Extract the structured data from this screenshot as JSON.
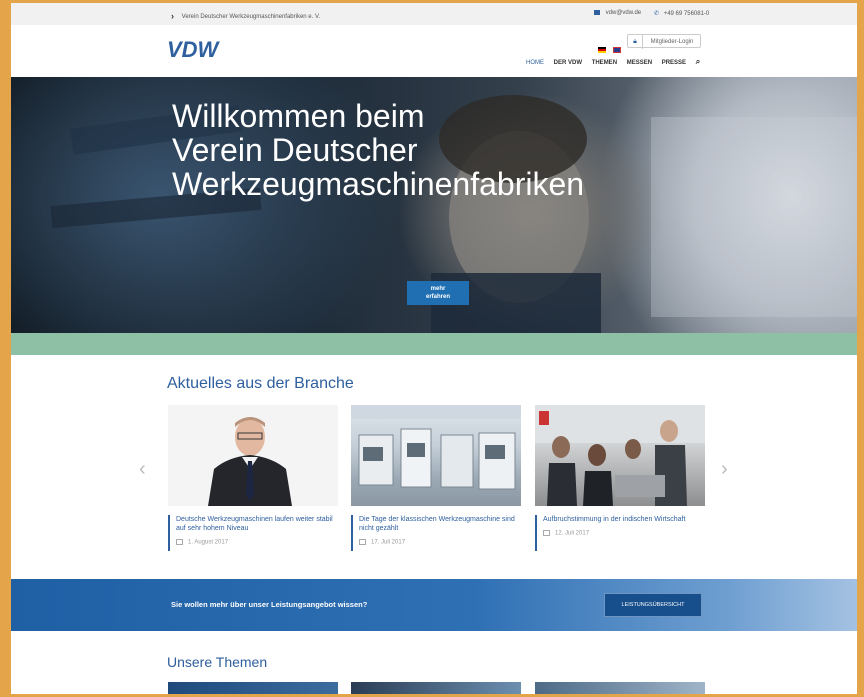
{
  "topbar": {
    "crumb": "Verein Deutscher Werkzeugmaschinenfabriken e. V.",
    "email": "vdw@vdw.de",
    "phone": "+49 69 756081-0"
  },
  "header": {
    "logo": "VDW",
    "login_label": "Mitglieder-Login",
    "nav": [
      "HOME",
      "DER VDW",
      "THEMEN",
      "MESSEN",
      "PRESSE"
    ]
  },
  "hero": {
    "title": "Willkommen beim\nVerein Deutscher\nWerkzeugmaschinenfabriken",
    "cta": "mehr\nerfahren"
  },
  "news": {
    "title": "Aktuelles aus der Branche",
    "items": [
      {
        "headline": "Deutsche Werkzeugmaschinen laufen weiter stabil auf sehr hohem Niveau",
        "date": "1. August 2017"
      },
      {
        "headline": "Die Tage der klassischen Werkzeugmaschine sind nicht gezählt",
        "date": "17. Juli 2017"
      },
      {
        "headline": "Aufbruchstimmung in der indischen Wirtschaft",
        "date": "12. Juli 2017"
      }
    ]
  },
  "banner": {
    "question": "Sie wollen mehr über unser Leistungsangebot wissen?",
    "button": "LEISTUNGSÜBERSICHT"
  },
  "themes": {
    "title": "Unsere Themen"
  },
  "colors": {
    "brand_blue": "#2e5f9e",
    "frame": "#e4a54a",
    "green_band": "#8dc0a4"
  }
}
